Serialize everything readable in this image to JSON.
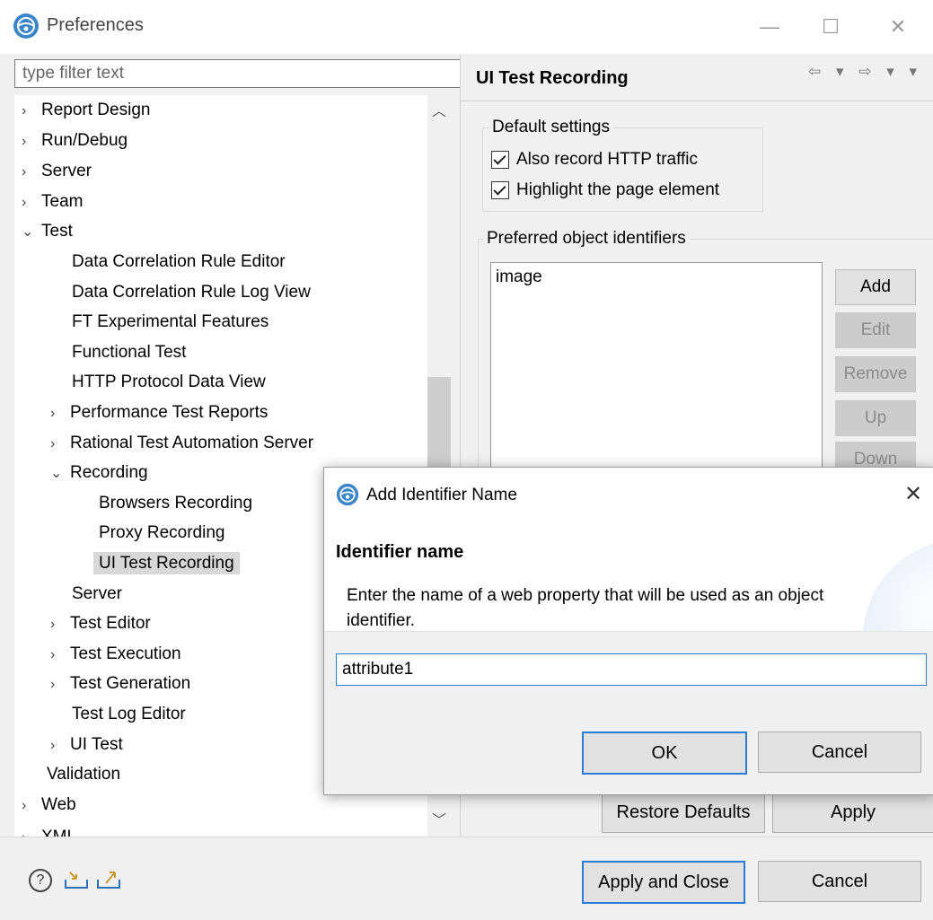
{
  "window": {
    "title": "Preferences"
  },
  "filter": {
    "placeholder": "type filter text"
  },
  "tree": {
    "items": [
      {
        "label": "Report Design",
        "chevron": ">"
      },
      {
        "label": "Run/Debug",
        "chevron": ">"
      },
      {
        "label": "Server",
        "chevron": ">"
      },
      {
        "label": "Team",
        "chevron": ">"
      },
      {
        "label": "Test",
        "chevron": "v"
      },
      {
        "label": "Data Correlation Rule Editor",
        "chevron": ""
      },
      {
        "label": "Data Correlation Rule Log View",
        "chevron": ""
      },
      {
        "label": "FT Experimental Features",
        "chevron": ""
      },
      {
        "label": "Functional Test",
        "chevron": ""
      },
      {
        "label": "HTTP Protocol Data View",
        "chevron": ""
      },
      {
        "label": "Performance Test Reports",
        "chevron": ">"
      },
      {
        "label": "Rational Test Automation Server",
        "chevron": ">"
      },
      {
        "label": "Recording",
        "chevron": "v"
      },
      {
        "label": "Browsers Recording",
        "chevron": ""
      },
      {
        "label": "Proxy Recording",
        "chevron": ""
      },
      {
        "label": "UI Test Recording",
        "chevron": ""
      },
      {
        "label": "Server",
        "chevron": ""
      },
      {
        "label": "Test Editor",
        "chevron": ">"
      },
      {
        "label": "Test Execution",
        "chevron": ">"
      },
      {
        "label": "Test Generation",
        "chevron": ">"
      },
      {
        "label": "Test Log Editor",
        "chevron": ""
      },
      {
        "label": "UI Test",
        "chevron": ">"
      },
      {
        "label": "Validation",
        "chevron": ""
      },
      {
        "label": "Web",
        "chevron": ">"
      },
      {
        "label": "XML",
        "chevron": ">"
      }
    ]
  },
  "page": {
    "title": "UI Test Recording",
    "nav_arrows": "⇦ ▾ ⇨ ▾ ▾",
    "default_settings": {
      "label": "Default settings",
      "checkbox_http": "Also record HTTP traffic",
      "checkbox_highlight": "Highlight the page element"
    },
    "identifiers": {
      "label": "Preferred object identifiers",
      "items": [
        "image"
      ],
      "add": "Add",
      "edit": "Edit",
      "remove": "Remove",
      "up": "Up",
      "down": "Down"
    },
    "restore_defaults": "Restore Defaults",
    "apply": "Apply"
  },
  "footer": {
    "help": "?",
    "apply_close": "Apply and Close",
    "cancel": "Cancel"
  },
  "dialog": {
    "title": "Add Identifier Name",
    "heading": "Identifier name",
    "message": "Enter the name of a web property that will be used as an object identifier.",
    "input_value": "attribute1",
    "ok": "OK",
    "cancel": "Cancel"
  },
  "colors": {
    "accent": "#2c7bd6",
    "selection": "#d8d8d8"
  }
}
